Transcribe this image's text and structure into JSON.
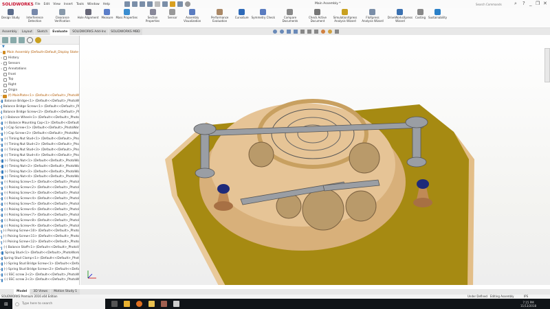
{
  "app": {
    "logo": "SOLIDWORKS",
    "menus": [
      "File",
      "Edit",
      "View",
      "Insert",
      "Tools",
      "Window",
      "Help"
    ],
    "doc_title": "Main Assembly *",
    "search_placeholder": "Search Commands"
  },
  "commands": [
    {
      "label": "Design Study",
      "color": "#5a6b8a"
    },
    {
      "label": "Interference Detection",
      "color": "#7788aa"
    },
    {
      "label": "Clearance Verification",
      "color": "#8899aa"
    },
    {
      "label": "Hole Alignment",
      "color": "#667"
    },
    {
      "label": "Measure",
      "color": "#5b7ec9"
    },
    {
      "label": "Mass Properties",
      "color": "#3a8dd0"
    },
    {
      "label": "Section Properties",
      "color": "#889"
    },
    {
      "label": "Sensor",
      "color": "#999"
    },
    {
      "label": "Assembly Visualization",
      "color": "#5a7cc0"
    },
    {
      "label": "Performance Evaluation",
      "color": "#aa8866"
    },
    {
      "label": "Curvature",
      "color": "#2e6ab8"
    },
    {
      "label": "Symmetry Check",
      "color": "#5a7cc0"
    },
    {
      "label": "Compare Documents",
      "color": "#888"
    },
    {
      "label": "Check Active Document",
      "color": "#777"
    },
    {
      "label": "SimulationXpress Analysis Wizard",
      "color": "#c8a020"
    },
    {
      "label": "FloXpress Analysis Wizard",
      "color": "#7a8ea8"
    },
    {
      "label": "DriveWorksXpress Wizard",
      "color": "#3a70b0"
    },
    {
      "label": "Costing",
      "color": "#888"
    },
    {
      "label": "Sustainability",
      "color": "#2a80c8"
    }
  ],
  "tabs": [
    {
      "label": "Assembly"
    },
    {
      "label": "Layout"
    },
    {
      "label": "Sketch"
    },
    {
      "label": "Evaluate",
      "active": true
    },
    {
      "label": "SOLIDWORKS Add-Ins"
    },
    {
      "label": "SOLIDWORKS MBD"
    }
  ],
  "tree": {
    "items": [
      {
        "label": "Main Assembly  (Default<Default_Display State-",
        "type": "root"
      },
      {
        "label": "History",
        "type": "folder"
      },
      {
        "label": "Sensors",
        "type": "folder"
      },
      {
        "label": "Annotations",
        "type": "folder"
      },
      {
        "label": "Front",
        "type": "plane"
      },
      {
        "label": "Top",
        "type": "plane"
      },
      {
        "label": "Right",
        "type": "plane"
      },
      {
        "label": "Origin",
        "type": "plane"
      },
      {
        "label": "(f) MainPlate<1> (Default<<Default>_PhotoW",
        "type": "root"
      },
      {
        "label": "Balance Bridge<1> (Default<<Default>_PhotoW"
      },
      {
        "label": "Balance Bridge Screw<1> (Default<<Default>_Pl"
      },
      {
        "label": "Balance Bridge Screw<2> (Default<<Default>_Pl"
      },
      {
        "label": "(-) Balance Wheel<1> (Default<<Default>_Photo"
      },
      {
        "label": "(-) Balance Mounting Cap<1> (Default<<Default"
      },
      {
        "label": "(-) Cap Screw<1> (Default<<Default>_PhotoWor"
      },
      {
        "label": "(-) Cap Screw<2> (Default<<Default>_PhotoWor"
      },
      {
        "label": "(-) Timing Nut Stud<1> (Default<<Default>_Pho"
      },
      {
        "label": "(-) Timing Nut Stud<2> (Default<<Default>_Pho"
      },
      {
        "label": "(-) Timing Nut Stud<3> (Default<<Default>_Pho"
      },
      {
        "label": "(-) Timing Nut Stud<4> (Default<<Default>_Pho"
      },
      {
        "label": "(-) Timing Nut<1> (Default<<Default>_PhotoWo"
      },
      {
        "label": "(-) Timing Nut<2> (Default<<Default>_PhotoWo"
      },
      {
        "label": "(-) Timing Nut<3> (Default<<Default>_PhotoWo"
      },
      {
        "label": "(-) Timing Nut<4> (Default<<Default>_PhotoWo"
      },
      {
        "label": "(-) Poising Screw<1> (Default<<Default>_Photol"
      },
      {
        "label": "(-) Poising Screw<2> (Default<<Default>_Photol"
      },
      {
        "label": "(-) Poising Screw<3> (Default<<Default>_Photol"
      },
      {
        "label": "(-) Poising Screw<4> (Default<<Default>_Photol"
      },
      {
        "label": "(-) Poising Screw<5> (Default<<Default>_Photol"
      },
      {
        "label": "(-) Poising Screw<6> (Default<<Default>_Photol"
      },
      {
        "label": "(-) Poising Screw<7> (Default<<Default>_Photol"
      },
      {
        "label": "(-) Poising Screw<8> (Default<<Default>_Photol"
      },
      {
        "label": "(-) Poising Screw<9> (Default<<Default>_Photol"
      },
      {
        "label": "(-) Poising Screw<10> (Default<<Default>_Photo"
      },
      {
        "label": "(-) Poising Screw<11> (Default<<Default>_Photo"
      },
      {
        "label": "(-) Poising Screw<12> (Default<<Default>_Photo"
      },
      {
        "label": "(-) Balance Staff<1> (Default<<Default>_PhotoV"
      },
      {
        "label": "Spring Stud<1> (Default<<Default>_PhotoWork"
      },
      {
        "label": "Spring Stud Clamp<1> (Default<<Default>_Phot"
      },
      {
        "label": "(-) Spring Stud Bridge Screw<1> (Default<<Defa"
      },
      {
        "label": "(-) Spring Stud Bridge Screw<2> (Default<<Defa"
      },
      {
        "label": "(-) SSC screw 2<2> (Default<<Default>_PhotoW"
      },
      {
        "label": "(-) SSC screw 2<3> (Default<<Default>_PhotoW"
      }
    ]
  },
  "bottom_tabs": [
    {
      "label": "Model",
      "active": true
    },
    {
      "label": "3D Views"
    },
    {
      "label": "Motion Study 1"
    }
  ],
  "status": {
    "edition": "SOLIDWORKS Premium 2016 x64 Edition",
    "state": "Under Defined",
    "mode": "Editing Assembly",
    "units": "IPS"
  },
  "taskbar": {
    "search_placeholder": "Type here to search",
    "time": "7:15 PM",
    "date": "11/13/2018"
  }
}
